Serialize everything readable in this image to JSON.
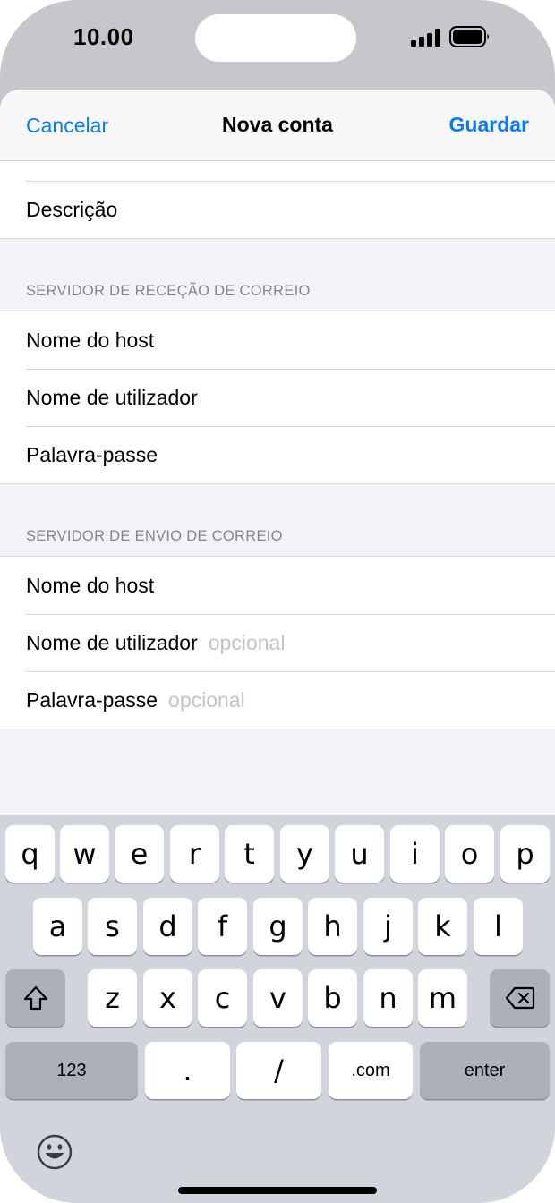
{
  "status_bar": {
    "time": "10.00"
  },
  "nav": {
    "cancel": "Cancelar",
    "title": "Nova conta",
    "save": "Guardar"
  },
  "form": {
    "description_label": "Descrição",
    "incoming": {
      "header": "SERVIDOR DE RECEÇÃO DE CORREIO",
      "host_label": "Nome do host",
      "user_label": "Nome de utilizador",
      "password_label": "Palavra-passe"
    },
    "outgoing": {
      "header": "SERVIDOR DE ENVIO DE CORREIO",
      "host_label": "Nome do host",
      "user_label": "Nome de utilizador",
      "user_placeholder": "opcional",
      "password_label": "Palavra-passe",
      "password_placeholder": "opcional"
    }
  },
  "keyboard": {
    "row1": [
      "q",
      "w",
      "e",
      "r",
      "t",
      "y",
      "u",
      "i",
      "o",
      "p"
    ],
    "row2": [
      "a",
      "s",
      "d",
      "f",
      "g",
      "h",
      "j",
      "k",
      "l"
    ],
    "row3": [
      "z",
      "x",
      "c",
      "v",
      "b",
      "n",
      "m"
    ],
    "numbers": "123",
    "dot": ".",
    "slash": "/",
    "dotcom": ".com",
    "enter": "enter",
    "shift_icon": "shift-icon",
    "delete_icon": "delete-icon",
    "emoji_icon": "emoji-icon"
  },
  "colors": {
    "accent": "#0a7aff",
    "placeholder": "#c4c4c7",
    "keyboard_bg": "#d1d4db"
  }
}
